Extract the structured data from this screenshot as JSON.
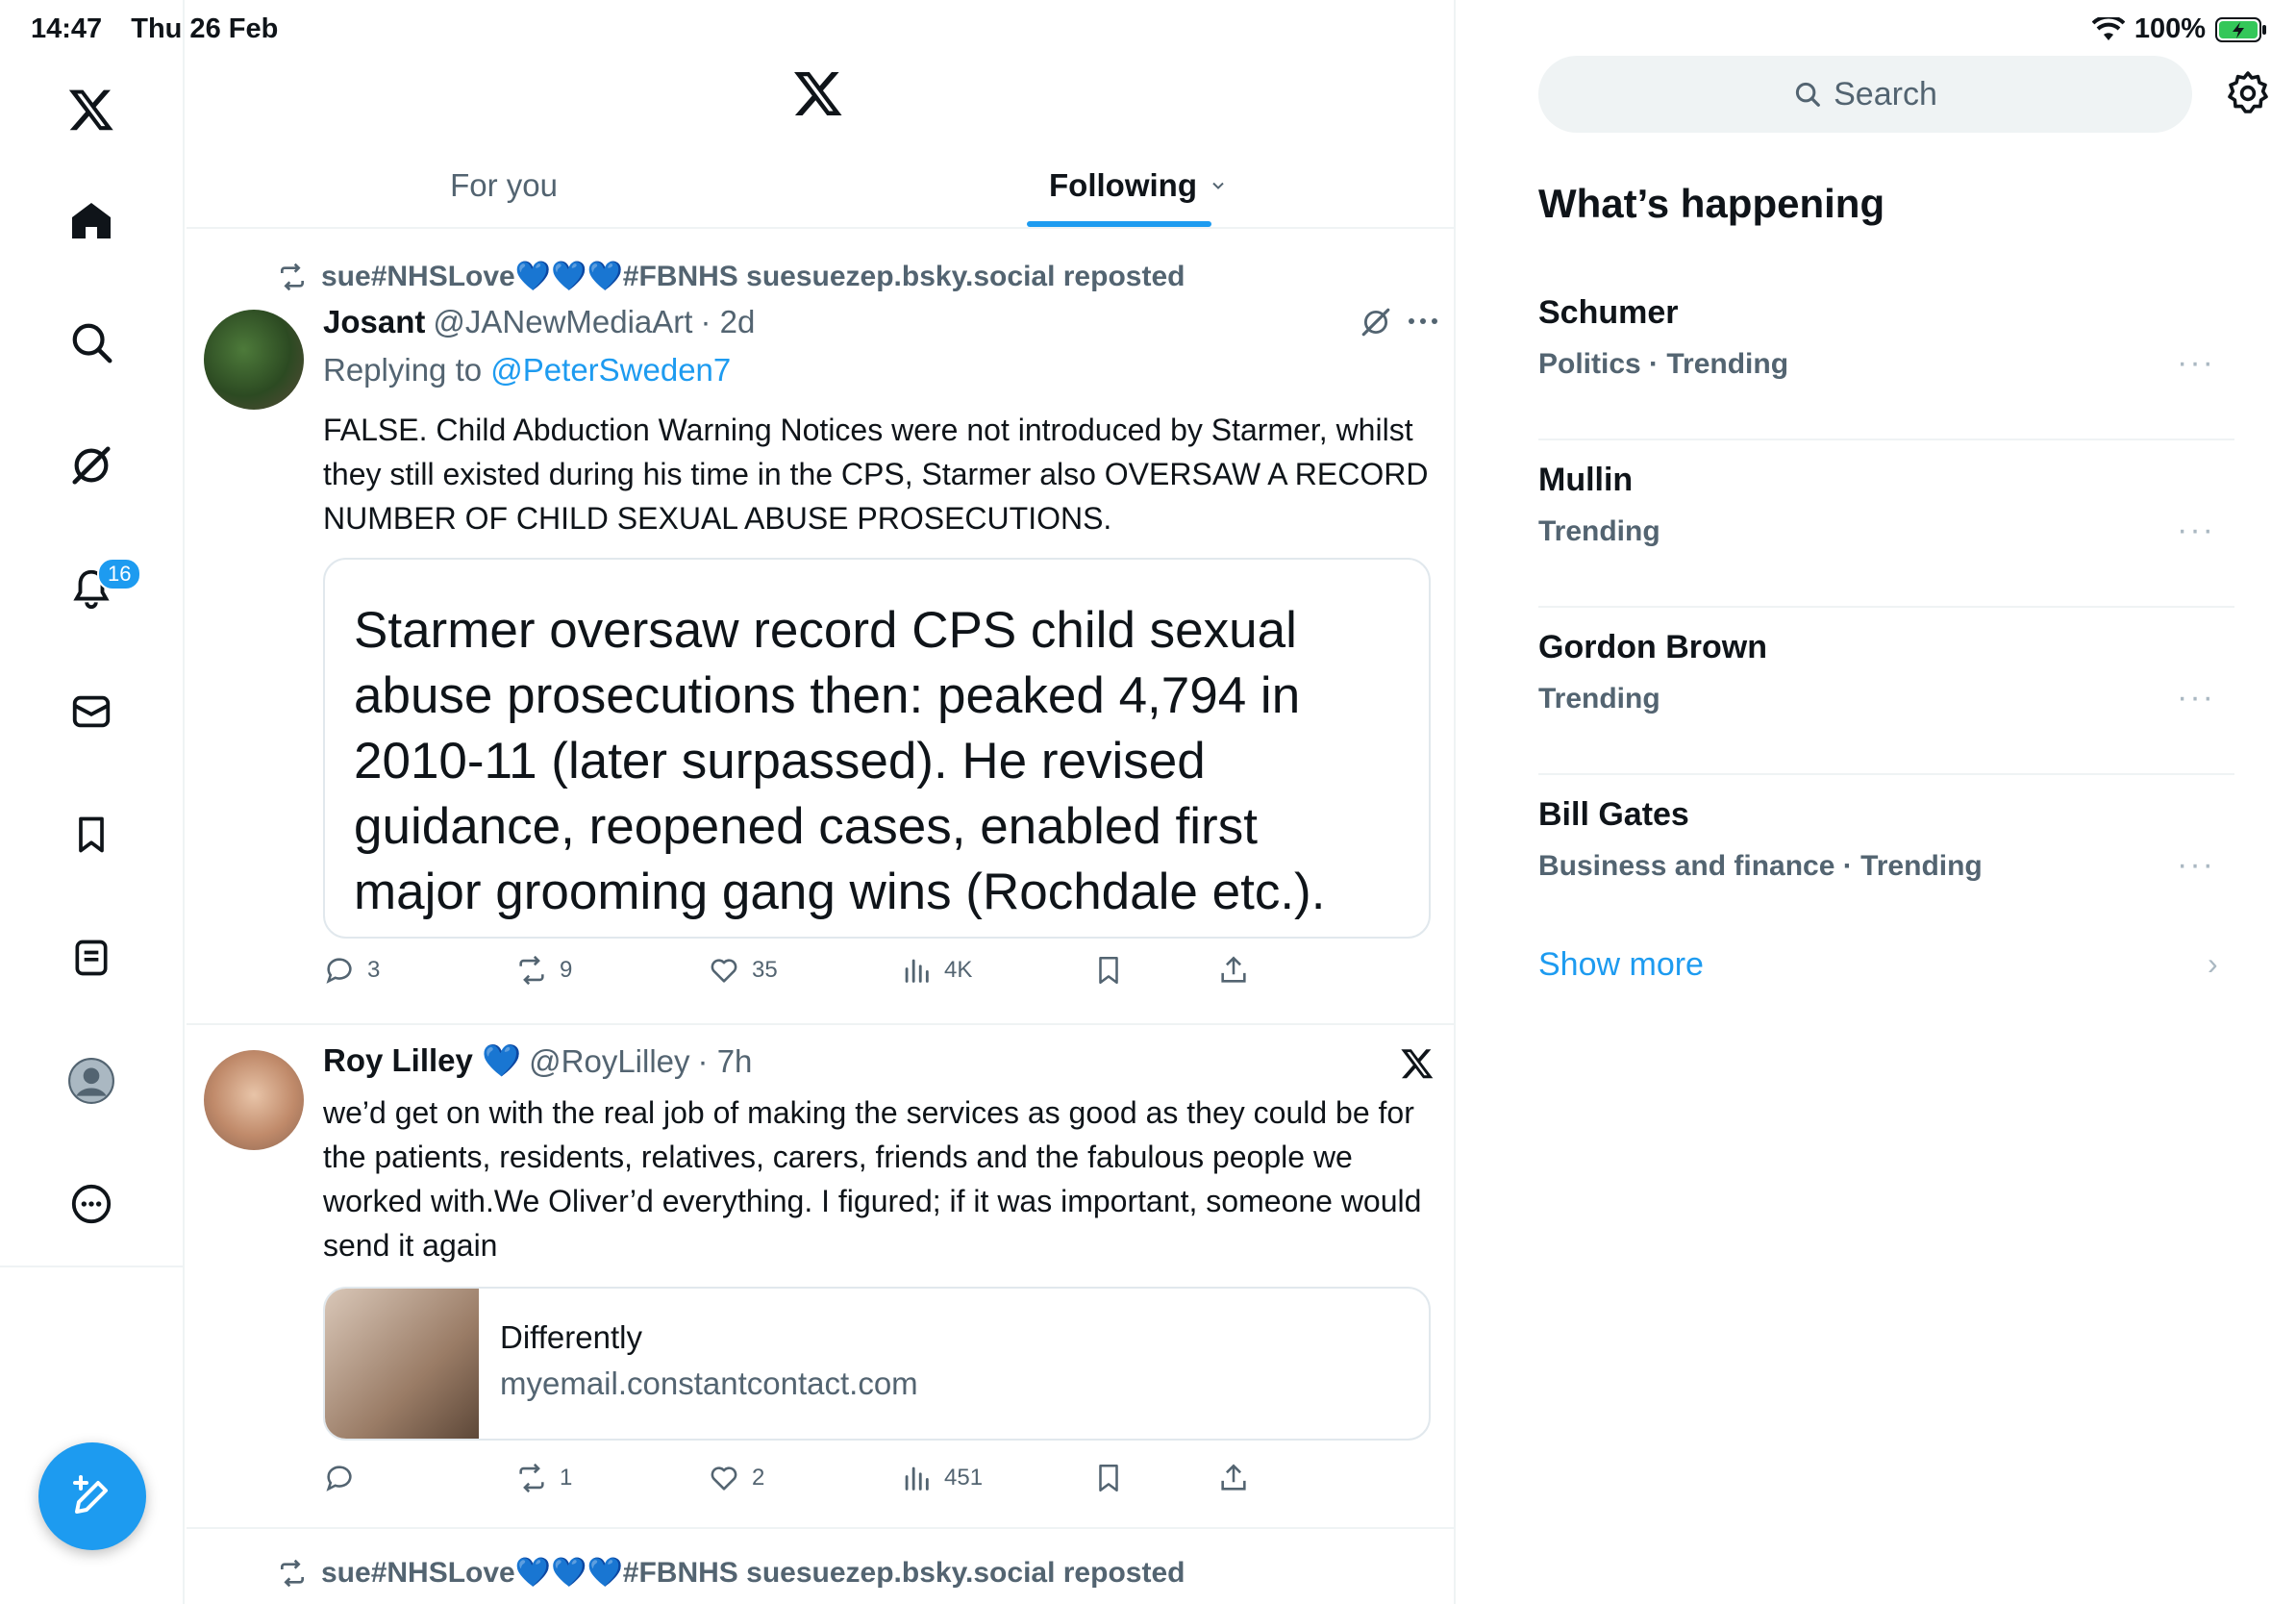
{
  "status": {
    "time": "14:47",
    "date": "Thu 26 Feb",
    "battery": "100%"
  },
  "nav": {
    "notification_count": "16"
  },
  "tabs": {
    "for_you": "For you",
    "following": "Following"
  },
  "posts": [
    {
      "repost_by": "sue#NHSLove💙💙💙#FBNHS suesuezep.bsky.social reposted",
      "name": "Josant",
      "handle": "@JANewMediaArt",
      "time": "· 2d",
      "replying_label": "Replying to",
      "replying_to": "@PeterSweden7",
      "text": "FALSE. Child Abduction Warning Notices were not introduced by Starmer, whilst they still existed during his time in the CPS, Starmer also OVERSAW A RECORD NUMBER OF CHILD SEXUAL ABUSE PROSECUTIONS.",
      "quote_text": "Starmer oversaw record CPS child sexual abuse prosecutions then: peaked 4,794 in 2010-11 (later surpassed). He revised guidance, reopened cases, enabled first major grooming gang wins (Rochdale etc.).",
      "replies": "3",
      "reposts": "9",
      "likes": "35",
      "views": "4K"
    },
    {
      "name": "Roy Lilley 💙",
      "handle": "@RoyLilley",
      "time": "· 7h",
      "text": "we’d get on with the real job of making the services as good as they could be for the patients, residents, relatives, carers, friends and the fabulous people we worked with.We Oliver’d everything. I figured; if it was important, someone would send it again",
      "link_title": "Differently",
      "link_domain": "myemail.constantcontact.com",
      "replies": "",
      "reposts": "1",
      "likes": "2",
      "views": "451"
    },
    {
      "repost_by": "sue#NHSLove💙💙💙#FBNHS suesuezep.bsky.social reposted"
    }
  ],
  "sidebar": {
    "search_placeholder": "Search",
    "title": "What’s happening",
    "trends": [
      {
        "name": "Schumer",
        "meta": "Politics · Trending"
      },
      {
        "name": "Mullin",
        "meta": "Trending"
      },
      {
        "name": "Gordon Brown",
        "meta": "Trending"
      },
      {
        "name": "Bill Gates",
        "meta": "Business and finance · Trending"
      }
    ],
    "show_more": "Show more"
  },
  "colors": {
    "accent": "#1d9bf0",
    "text": "#0f1419",
    "muted": "#536471"
  }
}
